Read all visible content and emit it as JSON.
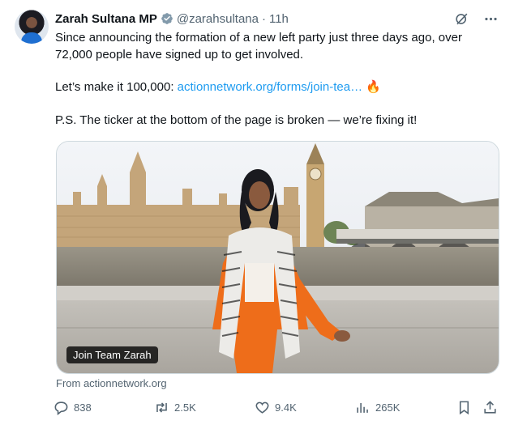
{
  "author": {
    "name": "Zarah Sultana MP",
    "handle": "@zarahsultana",
    "separator": "·",
    "time": "11h"
  },
  "tweet": {
    "line1": "Since announcing the formation of a new left party just three days ago, over 72,000 people have signed up to get involved.",
    "line2_prefix": "Let’s make it 100,000: ",
    "line2_link": "actionnetwork.org/forms/join-tea…",
    "line2_emoji": "🔥",
    "line3": "P.S. The ticker at the bottom of the page is broken — we’re fixing it!"
  },
  "card": {
    "title": "Join Team Zarah",
    "source": "From actionnetwork.org"
  },
  "actions": {
    "replies": "838",
    "reposts": "2.5K",
    "likes": "9.4K",
    "views": "265K"
  },
  "icons": {
    "verified": "verified-badge-icon",
    "grok": "grok-icon",
    "more": "more-icon",
    "reply": "reply-icon",
    "repost": "repost-icon",
    "like": "like-icon",
    "views": "views-icon",
    "bookmark": "bookmark-icon",
    "share": "share-icon"
  },
  "colors": {
    "link": "#1d9bf0",
    "muted": "#536471",
    "verified": "#829aab"
  }
}
